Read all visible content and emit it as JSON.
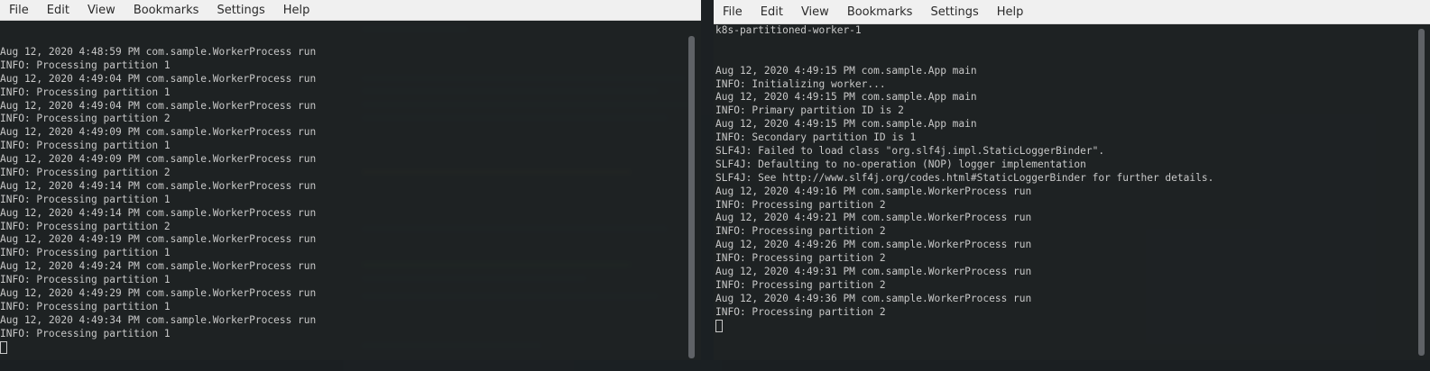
{
  "left_window": {
    "menu": [
      "File",
      "Edit",
      "View",
      "Bookmarks",
      "Settings",
      "Help"
    ],
    "lines": [
      "Aug 12, 2020 4:48:59 PM com.sample.WorkerProcess run",
      "INFO: Processing partition 1",
      "Aug 12, 2020 4:49:04 PM com.sample.WorkerProcess run",
      "INFO: Processing partition 1",
      "Aug 12, 2020 4:49:04 PM com.sample.WorkerProcess run",
      "INFO: Processing partition 2",
      "Aug 12, 2020 4:49:09 PM com.sample.WorkerProcess run",
      "INFO: Processing partition 1",
      "Aug 12, 2020 4:49:09 PM com.sample.WorkerProcess run",
      "INFO: Processing partition 2",
      "Aug 12, 2020 4:49:14 PM com.sample.WorkerProcess run",
      "INFO: Processing partition 1",
      "Aug 12, 2020 4:49:14 PM com.sample.WorkerProcess run",
      "INFO: Processing partition 2",
      "Aug 12, 2020 4:49:19 PM com.sample.WorkerProcess run",
      "INFO: Processing partition 1",
      "Aug 12, 2020 4:49:24 PM com.sample.WorkerProcess run",
      "INFO: Processing partition 1",
      "Aug 12, 2020 4:49:29 PM com.sample.WorkerProcess run",
      "INFO: Processing partition 1",
      "Aug 12, 2020 4:49:34 PM com.sample.WorkerProcess run",
      "INFO: Processing partition 1"
    ]
  },
  "right_window": {
    "menu": [
      "File",
      "Edit",
      "View",
      "Bookmarks",
      "Settings",
      "Help"
    ],
    "lines": [
      "k8s-partitioned-worker-1",
      "",
      "",
      "Aug 12, 2020 4:49:15 PM com.sample.App main",
      "INFO: Initializing worker...",
      "Aug 12, 2020 4:49:15 PM com.sample.App main",
      "INFO: Primary partition ID is 2",
      "Aug 12, 2020 4:49:15 PM com.sample.App main",
      "INFO: Secondary partition ID is 1",
      "SLF4J: Failed to load class \"org.slf4j.impl.StaticLoggerBinder\".",
      "SLF4J: Defaulting to no-operation (NOP) logger implementation",
      "SLF4J: See http://www.slf4j.org/codes.html#StaticLoggerBinder for further details.",
      "Aug 12, 2020 4:49:16 PM com.sample.WorkerProcess run",
      "INFO: Processing partition 2",
      "Aug 12, 2020 4:49:21 PM com.sample.WorkerProcess run",
      "INFO: Processing partition 2",
      "Aug 12, 2020 4:49:26 PM com.sample.WorkerProcess run",
      "INFO: Processing partition 2",
      "Aug 12, 2020 4:49:31 PM com.sample.WorkerProcess run",
      "INFO: Processing partition 2",
      "Aug 12, 2020 4:49:36 PM com.sample.WorkerProcess run",
      "INFO: Processing partition 2"
    ]
  },
  "colors": {
    "terminal_bg": "#1e2224",
    "terminal_fg": "#c8c8c8",
    "menubar_bg": "#f0f0f0"
  }
}
